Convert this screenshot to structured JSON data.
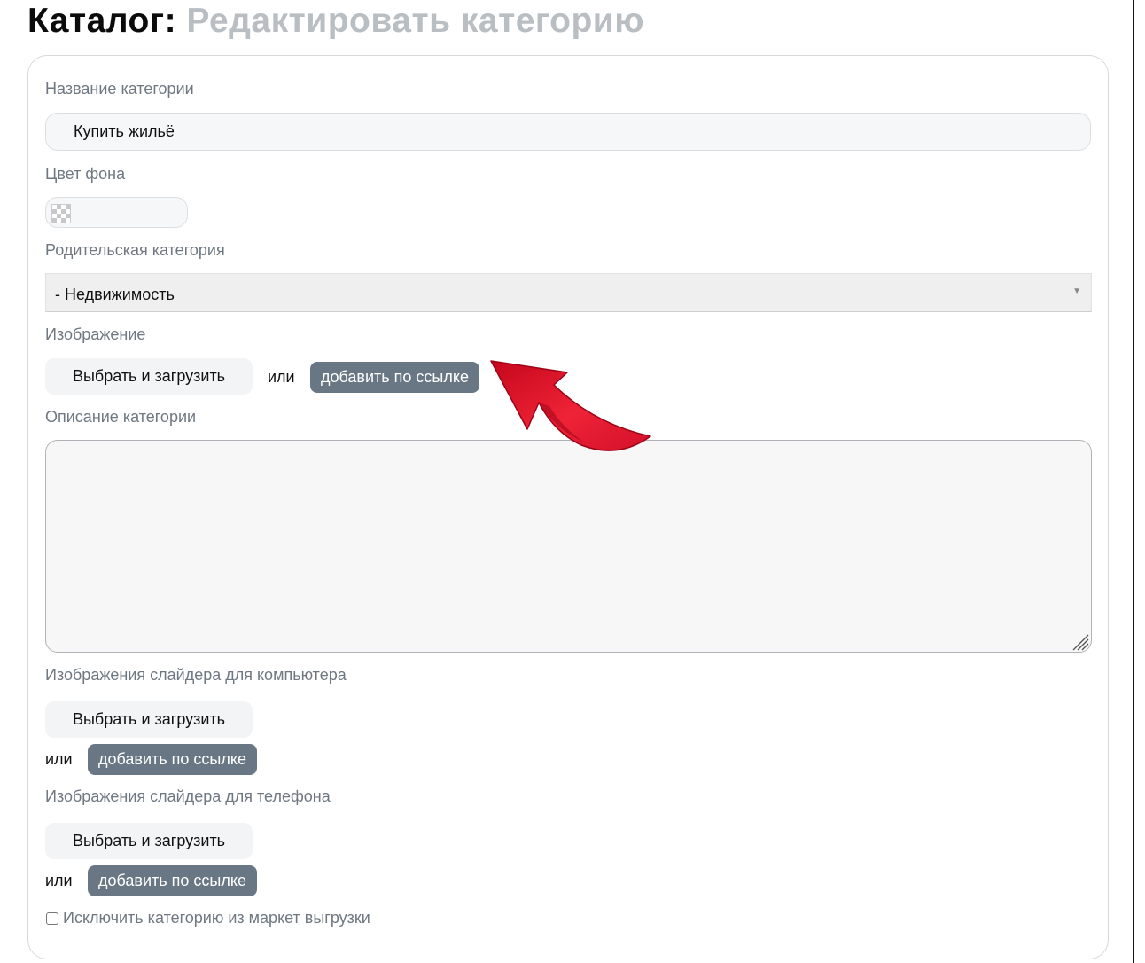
{
  "header": {
    "title_main": "Каталог:",
    "title_sub": "Редактировать категорию"
  },
  "form": {
    "name_label": "Название категории",
    "name_value": "Купить жильё",
    "bg_color_label": "Цвет фона",
    "parent_label": "Родительская категория",
    "parent_value": "- Недвижимость",
    "image_label": "Изображение",
    "upload_label": "Выбрать и загрузить",
    "or_label": "или",
    "add_link_label": "добавить по ссылке",
    "description_label": "Описание категории",
    "description_value": "",
    "slider_desktop_label": "Изображения слайдера для компьютера",
    "slider_mobile_label": "Изображения слайдера для телефона",
    "exclude_label": "Исключить категорию из маркет выгрузки",
    "exclude_checked": false
  },
  "colors": {
    "accent_button": "#697785",
    "annotation_arrow": "#e3172e"
  },
  "icons": {
    "transparent_swatch": "checkerboard-icon",
    "dropdown": "caret-down-icon",
    "annotation": "curved-arrow-icon"
  }
}
